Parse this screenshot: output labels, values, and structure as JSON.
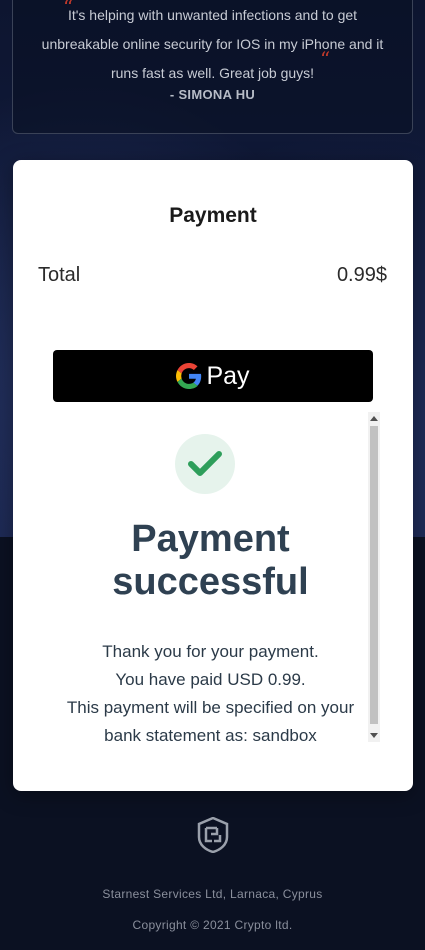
{
  "testimonial": {
    "text": "It's helping with unwanted infections and to get unbreakable online security for IOS in my iPhone and it runs fast as well. Great job guys!",
    "author": "- SIMONA HU"
  },
  "modal": {
    "title": "Payment",
    "total_label": "Total",
    "total_amount": "0.99$",
    "gpay_label": "Pay"
  },
  "confirmation": {
    "title": "Payment successful",
    "line1": "Thank you for your payment.",
    "line2": "You have paid USD 0.99.",
    "line3": "This payment will be specified on your bank statement as: sandbox"
  },
  "footer": {
    "company": "Starnest Services Ltd, Larnaca, Cyprus",
    "copyright": "Copyright © 2021 Crypto ltd."
  },
  "colors": {
    "background": "#0b1122",
    "success_green": "#2e9e5b",
    "quote_red": "#c0392b"
  }
}
